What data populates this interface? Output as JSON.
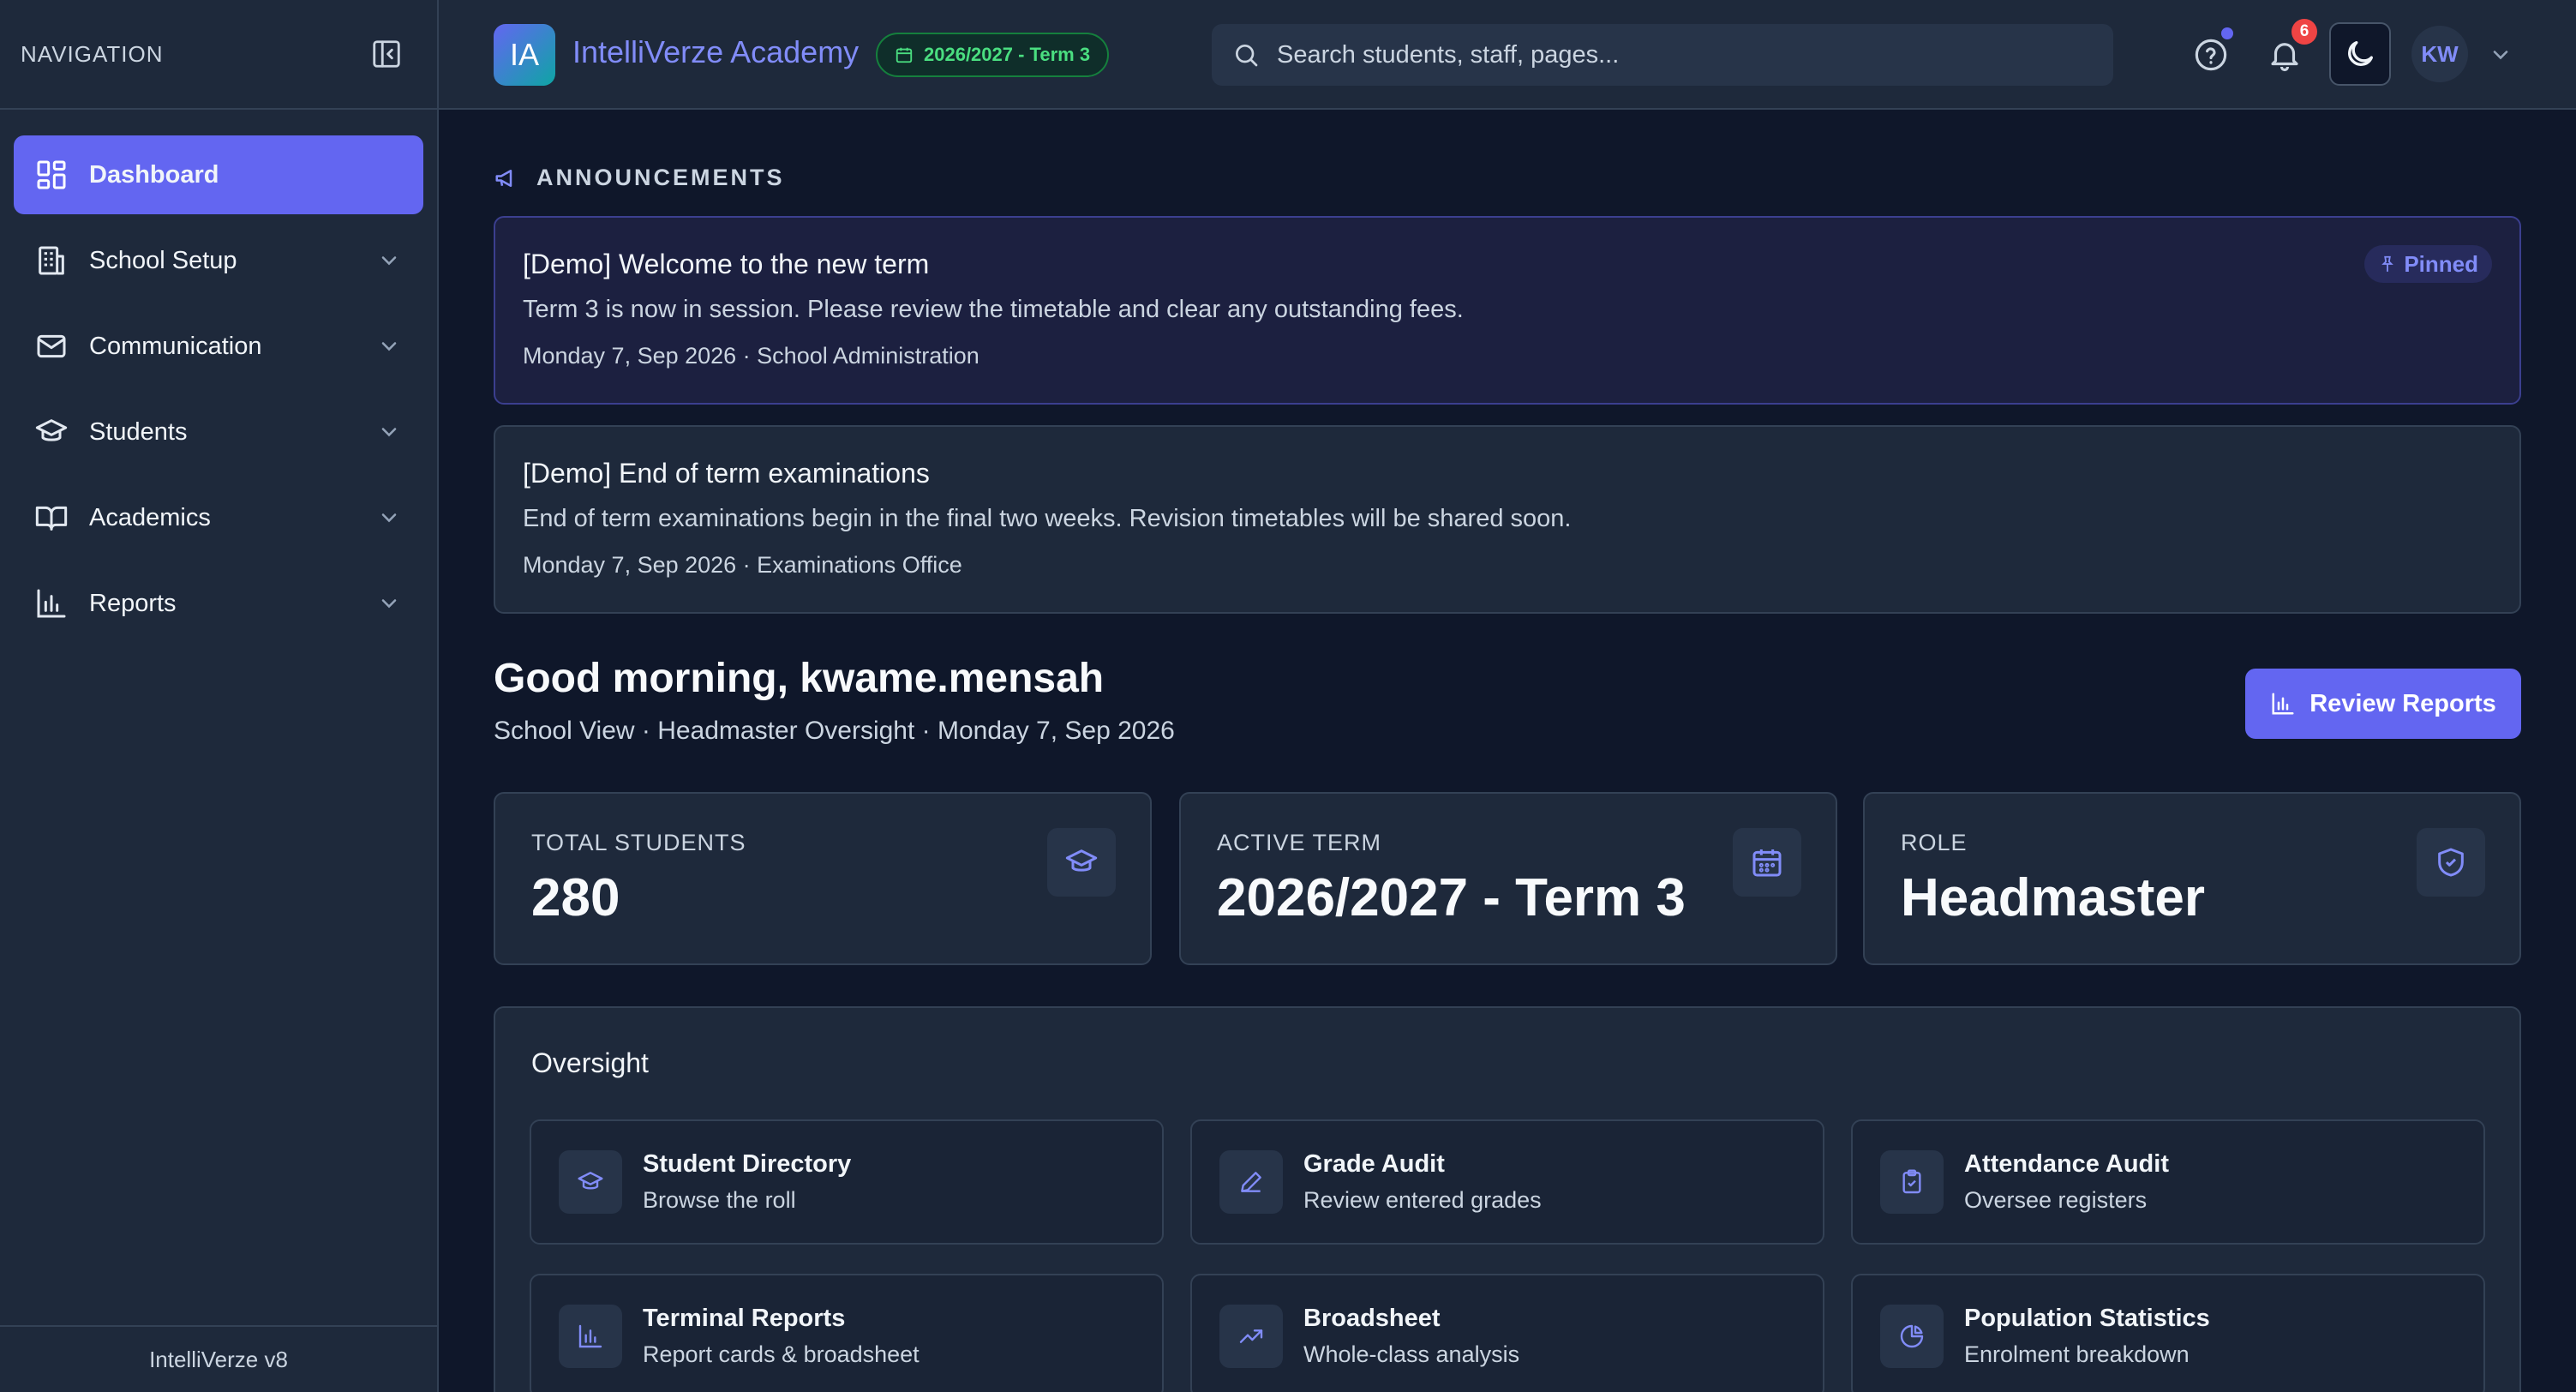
{
  "sidebar": {
    "title": "NAVIGATION",
    "items": [
      {
        "label": "Dashboard"
      },
      {
        "label": "School Setup"
      },
      {
        "label": "Communication"
      },
      {
        "label": "Students"
      },
      {
        "label": "Academics"
      },
      {
        "label": "Reports"
      }
    ],
    "footer": "IntelliVerze v8"
  },
  "header": {
    "logo_text": "IA",
    "app_name": "IntelliVerze Academy",
    "term": "2026/2027 - Term 3",
    "search_placeholder": "Search students, staff, pages...",
    "notification_count": "6",
    "avatar": "KW"
  },
  "announcements": {
    "title": "ANNOUNCEMENTS",
    "items": [
      {
        "title": "[Demo] Welcome to the new term",
        "body": "Term 3 is now in session. Please review the timetable and clear any outstanding fees.",
        "meta": "Monday 7, Sep 2026 · School Administration",
        "badge": "Pinned"
      },
      {
        "title": "[Demo] End of term examinations",
        "body": "End of term examinations begin in the final two weeks. Revision timetables will be shared soon.",
        "meta": "Monday 7, Sep 2026 · Examinations Office"
      }
    ]
  },
  "greeting": {
    "title": "Good morning, kwame.mensah",
    "subtitle": "School View · Headmaster Oversight · Monday 7, Sep 2026",
    "button": "Review Reports"
  },
  "stats": [
    {
      "label": "TOTAL STUDENTS",
      "value": "280",
      "icon": "graduation-cap-icon"
    },
    {
      "label": "ACTIVE TERM",
      "value": "2026/2027 - Term 3",
      "icon": "calendar-icon"
    },
    {
      "label": "ROLE",
      "value": "Headmaster",
      "icon": "shield-check-icon"
    }
  ],
  "oversight": {
    "title": "Oversight",
    "tiles": [
      {
        "title": "Student Directory",
        "subtitle": "Browse the roll",
        "icon": "graduation-cap-icon"
      },
      {
        "title": "Grade Audit",
        "subtitle": "Review entered grades",
        "icon": "pen-icon"
      },
      {
        "title": "Attendance Audit",
        "subtitle": "Oversee registers",
        "icon": "clipboard-check-icon"
      },
      {
        "title": "Terminal Reports",
        "subtitle": "Report cards & broadsheet",
        "icon": "bar-chart-icon"
      },
      {
        "title": "Broadsheet",
        "subtitle": "Whole-class analysis",
        "icon": "trending-up-icon"
      },
      {
        "title": "Population Statistics",
        "subtitle": "Enrolment breakdown",
        "icon": "pie-chart-icon"
      }
    ]
  },
  "colors": {
    "accent": "#6366f1",
    "background": "#0f172a",
    "panel": "#1e293b",
    "term_green": "#4ade80",
    "badge_red": "#ef4444"
  }
}
